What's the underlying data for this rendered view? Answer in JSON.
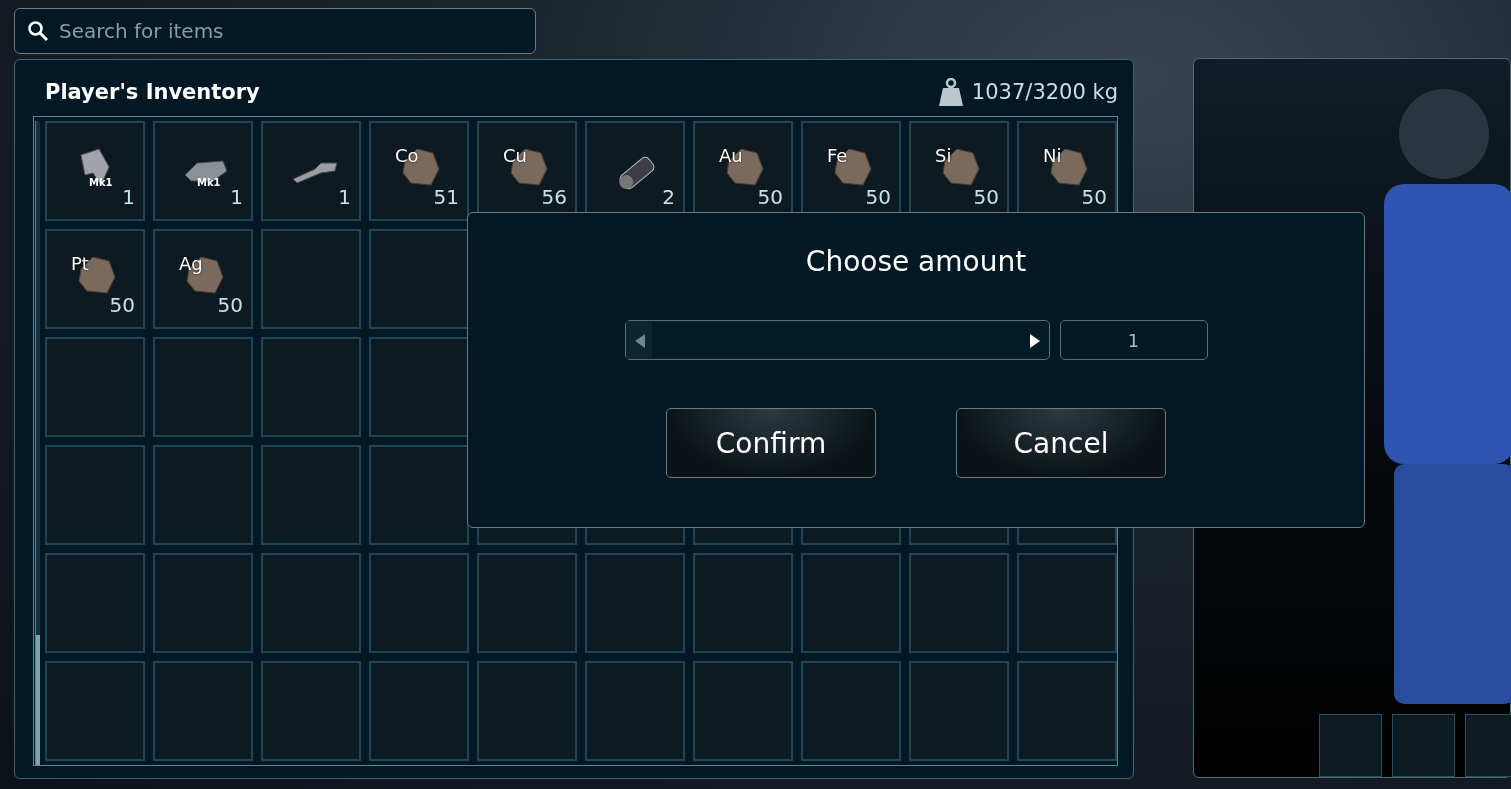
{
  "search": {
    "placeholder": "Search for items"
  },
  "inventory": {
    "title": "Player's Inventory",
    "weight": "1037/3200 kg",
    "slots": [
      {
        "kind": "tool",
        "badge": "Mk1",
        "count": "1"
      },
      {
        "kind": "drill",
        "badge": "Mk1",
        "count": "1"
      },
      {
        "kind": "gun",
        "count": "1"
      },
      {
        "kind": "ore",
        "symbol": "Co",
        "count": "51"
      },
      {
        "kind": "ore",
        "symbol": "Cu",
        "count": "56"
      },
      {
        "kind": "canister",
        "count": "2"
      },
      {
        "kind": "ore",
        "symbol": "Au",
        "count": "50"
      },
      {
        "kind": "ore",
        "symbol": "Fe",
        "count": "50"
      },
      {
        "kind": "ore",
        "symbol": "Si",
        "count": "50"
      },
      {
        "kind": "ore",
        "symbol": "Ni",
        "count": "50"
      },
      {
        "kind": "ore",
        "symbol": "Pt",
        "count": "50"
      },
      {
        "kind": "ore",
        "symbol": "Ag",
        "count": "50"
      },
      {
        "kind": "empty"
      },
      {
        "kind": "empty"
      },
      {
        "kind": "empty"
      },
      {
        "kind": "empty"
      },
      {
        "kind": "empty"
      },
      {
        "kind": "empty"
      },
      {
        "kind": "empty"
      },
      {
        "kind": "empty"
      },
      {
        "kind": "empty"
      },
      {
        "kind": "empty"
      },
      {
        "kind": "empty"
      },
      {
        "kind": "empty"
      },
      {
        "kind": "empty"
      },
      {
        "kind": "empty"
      },
      {
        "kind": "empty"
      },
      {
        "kind": "empty"
      },
      {
        "kind": "empty"
      },
      {
        "kind": "empty"
      },
      {
        "kind": "empty"
      },
      {
        "kind": "empty"
      },
      {
        "kind": "empty"
      },
      {
        "kind": "empty"
      },
      {
        "kind": "empty"
      },
      {
        "kind": "empty"
      },
      {
        "kind": "empty"
      },
      {
        "kind": "empty"
      },
      {
        "kind": "empty"
      },
      {
        "kind": "empty"
      },
      {
        "kind": "empty"
      },
      {
        "kind": "empty"
      },
      {
        "kind": "empty"
      },
      {
        "kind": "empty"
      },
      {
        "kind": "empty"
      },
      {
        "kind": "empty"
      },
      {
        "kind": "empty"
      },
      {
        "kind": "empty"
      },
      {
        "kind": "empty"
      },
      {
        "kind": "empty"
      },
      {
        "kind": "empty"
      },
      {
        "kind": "empty"
      },
      {
        "kind": "empty"
      },
      {
        "kind": "empty"
      },
      {
        "kind": "empty"
      },
      {
        "kind": "empty"
      },
      {
        "kind": "empty"
      },
      {
        "kind": "empty"
      },
      {
        "kind": "empty"
      },
      {
        "kind": "empty"
      }
    ]
  },
  "dialog": {
    "title": "Choose amount",
    "slider": {
      "level": 0
    },
    "value": "1",
    "buttons": [
      "Confirm",
      "Cancel"
    ]
  },
  "character": {
    "equipment_slots": [
      {
        "kind": "empty"
      },
      {
        "kind": "empty"
      },
      {
        "kind": "empty"
      }
    ]
  }
}
